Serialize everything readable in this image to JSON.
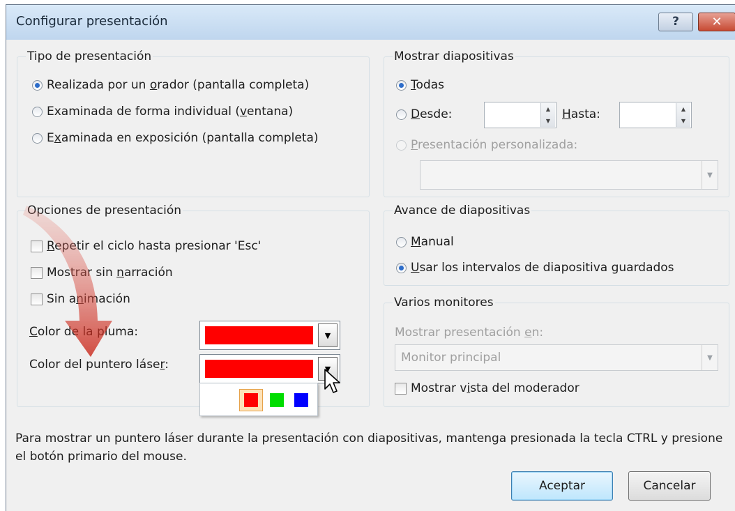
{
  "dialog": {
    "title": "Configurar presentación",
    "help_label": "?",
    "close_label": "✕"
  },
  "tipo": {
    "legend": "Tipo de presentación",
    "options": [
      {
        "pre": "Realizada por un ",
        "u": "o",
        "post": "rador (pantalla completa)",
        "selected": true
      },
      {
        "pre": "Examinada de forma individual (",
        "u": "v",
        "post": "entana)",
        "selected": false
      },
      {
        "pre": "E",
        "u": "x",
        "post": "aminada en exposición (pantalla completa)",
        "selected": false
      }
    ]
  },
  "mostrar": {
    "legend": "Mostrar diapositivas",
    "todas": {
      "u": "T",
      "post": "odas",
      "selected": true
    },
    "desde": {
      "u": "D",
      "post": "esde:",
      "value": "",
      "selected": false
    },
    "hasta": {
      "u": "H",
      "post": "asta:",
      "value": ""
    },
    "personalizada": {
      "u": "P",
      "post": "resentación personalizada:",
      "enabled": false
    },
    "personalizada_value": ""
  },
  "opciones": {
    "legend": "Opciones de presentación",
    "checks": [
      {
        "pre": "",
        "u": "R",
        "post": "epetir el ciclo hasta presionar 'Esc'",
        "checked": false
      },
      {
        "pre": "Mostrar sin ",
        "u": "n",
        "post": "arración",
        "checked": false
      },
      {
        "pre": "Sin a",
        "u": "n",
        "post": "imación",
        "checked": false
      }
    ],
    "pen_color": {
      "pre": "",
      "u": "C",
      "post": "olor de la pluma:",
      "color": "#ff0000"
    },
    "laser_color": {
      "pre": "Color del puntero láse",
      "u": "r",
      "post": ":",
      "color": "#ff0000"
    },
    "palette": [
      "#ff0000",
      "#00dd00",
      "#0000ff"
    ]
  },
  "avance": {
    "legend": "Avance de diapositivas",
    "options": [
      {
        "pre": "",
        "u": "M",
        "post": "anual",
        "selected": false
      },
      {
        "pre": "",
        "u": "U",
        "post": "sar los intervalos de diapositiva guardados",
        "selected": true
      }
    ]
  },
  "monitores": {
    "legend": "Varios monitores",
    "show_on": {
      "pre": "Mostrar presentación ",
      "u": "e",
      "post": "n:"
    },
    "monitor_value": "Monitor principal",
    "presenter": {
      "pre": "Mostrar v",
      "u": "i",
      "post": "sta del moderador",
      "checked": false
    }
  },
  "info_text": "Para mostrar un puntero láser durante la presentación con diapositivas, mantenga presionada la tecla CTRL y presione el botón primario del mouse.",
  "buttons": {
    "ok": "Aceptar",
    "cancel": "Cancelar"
  }
}
